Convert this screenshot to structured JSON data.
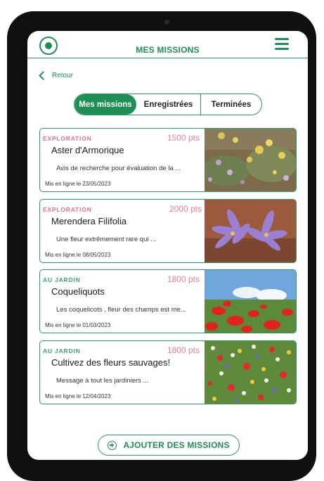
{
  "colors": {
    "accent": "#1f8f55",
    "points": "#ec7c97",
    "category_exploration": "#e46f8f",
    "category_garden": "#3aa86b"
  },
  "header": {
    "title": "MES MISSIONS",
    "logo_icon": "clover-logo-icon",
    "menu_icon": "hamburger-menu-icon"
  },
  "back": {
    "label": "Retour",
    "icon": "chevron-left-icon"
  },
  "tabs": [
    {
      "label": "Mes missions",
      "active": true
    },
    {
      "label": "Enregistrées",
      "active": false
    },
    {
      "label": "Terminées",
      "active": false
    }
  ],
  "missions": [
    {
      "category": "EXPLORATION",
      "points": "1500 pts",
      "name": "Aster d'Armorique",
      "description": "Avis de recherche pour évaluation de la ...",
      "date": "Mis en ligne le 23/05/2023"
    },
    {
      "category": "EXPLORATION",
      "points": "2000 pts",
      "name": "Merendera Filifolia",
      "description": "Une fleur extrêmement rare qui ...",
      "date": "Mis en ligne le 08/05/2023"
    },
    {
      "category": "AU JARDIN",
      "points": "1800 pts",
      "name": "Coqueliquots",
      "description": "Les coquelicots , fleur des champs est me...",
      "date": "Mis en ligne le 01/03/2023"
    },
    {
      "category": "AU JARDIN",
      "points": "1800 pts",
      "name": "Cultivez des fleurs sauvages!",
      "description": "Message à tout les jardiniers ...",
      "date": "Mis en ligne le 12/04/2023"
    }
  ],
  "add_button": {
    "label": "AJOUTER DES MISSIONS",
    "icon": "plus-circle-icon"
  }
}
